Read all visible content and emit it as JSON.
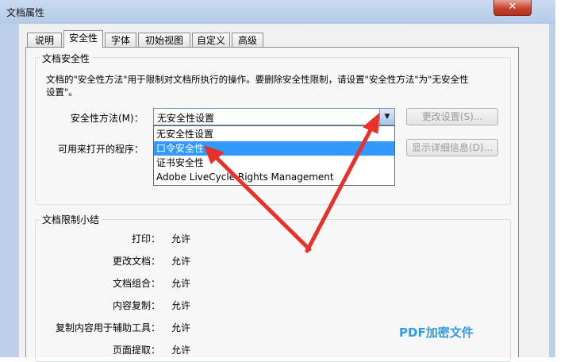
{
  "window": {
    "title": "文档属性",
    "close_glyph": "✕"
  },
  "tabs": [
    {
      "label": "说明"
    },
    {
      "label": "安全性",
      "active": true
    },
    {
      "label": "字体"
    },
    {
      "label": "初始视图"
    },
    {
      "label": "自定义"
    },
    {
      "label": "高级"
    }
  ],
  "security_group": {
    "legend": "文档安全性",
    "description": "文档的\"安全性方法\"用于限制对文档所执行的操作。要删除安全性限制，请设置\"安全性方法\"为\"无安全性设置\"。",
    "method_label": "安全性方法(M)：",
    "method_value": "无安全性设置",
    "openable_label": "可用来打开的程序：",
    "change_settings_button": "更改设置(S)...",
    "show_details_button": "显示详细信息(D)...",
    "dropdown_options": [
      {
        "label": "无安全性设置"
      },
      {
        "label": "口令安全性",
        "selected": true
      },
      {
        "label": "证书安全性"
      },
      {
        "label": "Adobe LiveCycle Rights Management"
      }
    ]
  },
  "restrictions_group": {
    "legend": "文档限制小结",
    "rows": [
      {
        "label": "打印：",
        "value": "允许"
      },
      {
        "label": "更改文档：",
        "value": "允许"
      },
      {
        "label": "文档组合：",
        "value": "允许"
      },
      {
        "label": "内容复制：",
        "value": "允许"
      },
      {
        "label": "复制内容用于辅助工具：",
        "value": "允许"
      },
      {
        "label": "页面提取：",
        "value": "允许"
      }
    ]
  },
  "watermark": "PDF加密文件",
  "colors": {
    "selection": "#3399ff",
    "annotation_arrow": "#e8312a",
    "watermark": "#2f9be0"
  }
}
